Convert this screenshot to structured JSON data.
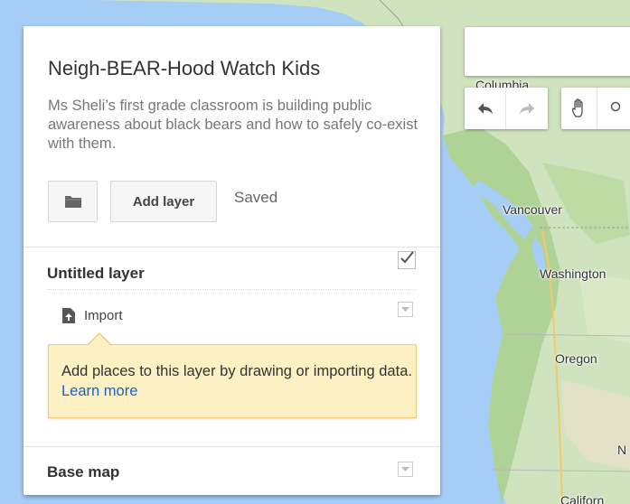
{
  "map": {
    "title": "Neigh-BEAR-Hood Watch Kids",
    "description": "Ms Sheli’s first grade classroom is building public awareness about black bears and how to safely co-exist with them.",
    "add_layer_label": "Add layer",
    "save_status": "Saved",
    "folder_icon": "folder-icon"
  },
  "layer": {
    "name": "Untitled layer",
    "visible": true,
    "import_label": "Import",
    "hint_text": "Add places to this layer by drawing or importing data. ",
    "learn_more": "Learn more"
  },
  "base_map": {
    "label": "Base map"
  },
  "map_labels": {
    "columbia": "Columbia",
    "vancouver": "Vancouver",
    "washington": "Washington",
    "oregon": "Oregon",
    "nevada_partial": "N",
    "california_partial": "Californ"
  },
  "toolbar": {
    "undo_icon": "undo-icon",
    "redo_icon": "redo-icon",
    "pan_icon": "hand-icon"
  },
  "colors": {
    "water": "#a6cdf6",
    "land": "#cfe3bf",
    "forest": "#a9cf8f",
    "hint_bg": "#fdf1c3",
    "link": "#1a62c9"
  }
}
